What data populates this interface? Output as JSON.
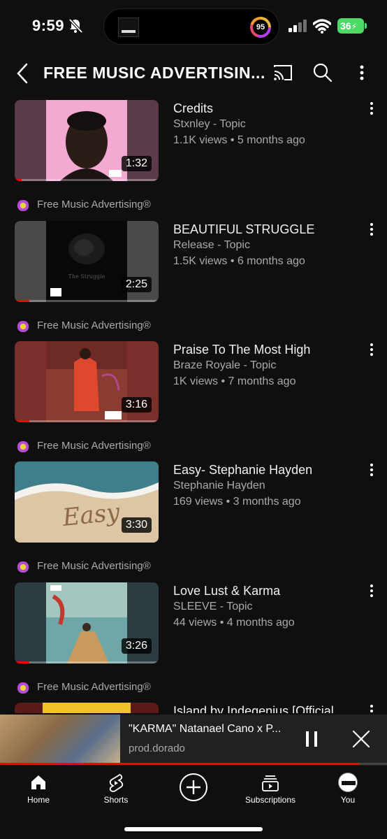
{
  "status_bar": {
    "time": "9:59",
    "activity_ring_value": "95",
    "battery": "36"
  },
  "header": {
    "title": "FREE MUSIC ADVERTISIN...",
    "icons": [
      "back-icon",
      "cast-icon",
      "search-icon",
      "more-vertical-icon"
    ]
  },
  "videos": [
    {
      "title": "Credits",
      "channel": "Stxnley - Topic",
      "meta": "1.1K views • 5 months ago",
      "duration": "1:32",
      "watched": 0.05
    },
    {
      "title": "BEAUTIFUL STRUGGLE",
      "channel": "Release - Topic",
      "meta": "1.5K views • 6 months ago",
      "duration": "2:25",
      "watched": 0.1
    },
    {
      "title": "Praise To The Most High",
      "channel": "Braze Royale - Topic",
      "meta": "1K views • 7 months ago",
      "duration": "3:16",
      "watched": 0.1
    },
    {
      "title": "Easy- Stephanie Hayden",
      "channel": "Stephanie Hayden",
      "meta": "169 views • 3 months ago",
      "duration": "3:30",
      "watched": 0
    },
    {
      "title": "Love Lust & Karma",
      "channel": "SLEEVE - Topic",
      "meta": "44 views • 4 months ago",
      "duration": "3:26",
      "watched": 0.1
    },
    {
      "title": "Island by Indegenius [Official",
      "channel": "",
      "meta": "",
      "duration": "",
      "watched": 0
    }
  ],
  "source": {
    "name": "Free Music Advertising®"
  },
  "mini_player": {
    "title": "\"KARMA\" Natanael Cano x P...",
    "subtitle": "prod.dorado",
    "progress": 0.93
  },
  "bottom_nav": [
    {
      "label": "Home",
      "icon": "home-icon"
    },
    {
      "label": "Shorts",
      "icon": "shorts-icon"
    },
    {
      "label": "",
      "icon": "create-plus-icon"
    },
    {
      "label": "Subscriptions",
      "icon": "subscriptions-icon"
    },
    {
      "label": "You",
      "icon": "avatar"
    }
  ],
  "colors": {
    "background": "#0f0f0f",
    "accent_red": "#ff0000",
    "secondary_text": "#aaaaaa",
    "battery_green": "#4cd964"
  }
}
